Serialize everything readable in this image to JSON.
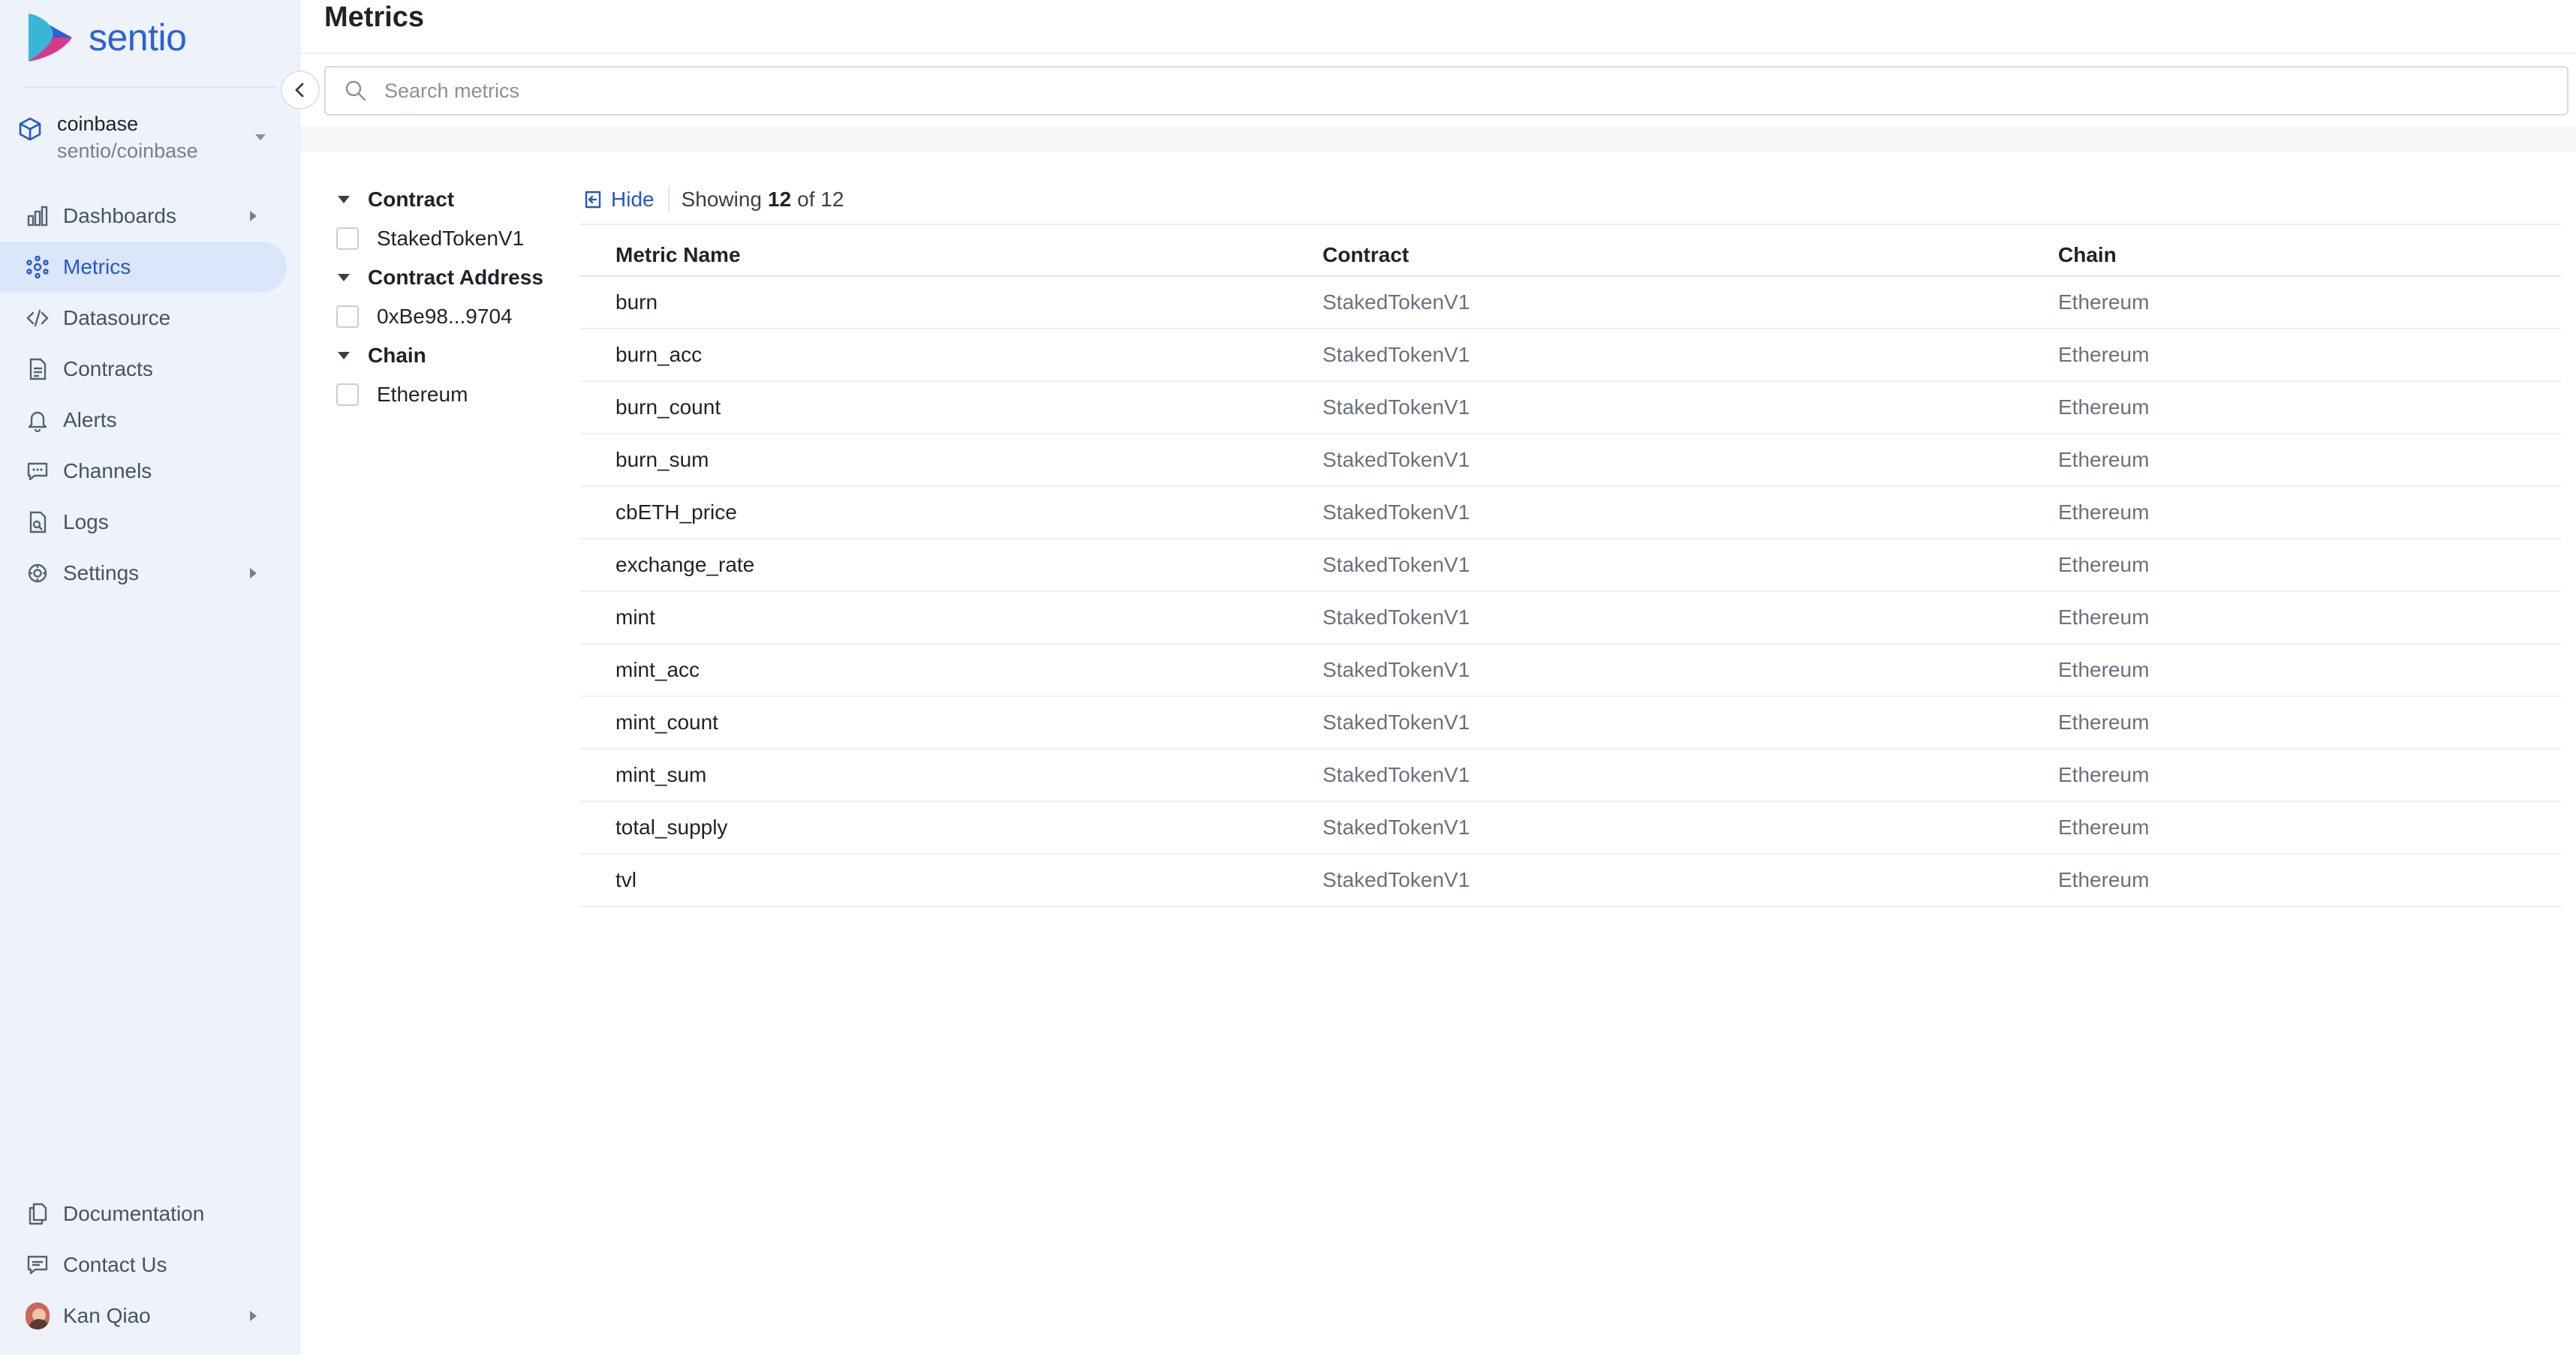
{
  "brand": {
    "name": "sentio"
  },
  "project": {
    "name": "coinbase",
    "slug": "sentio/coinbase"
  },
  "nav": {
    "items": [
      {
        "label": "Dashboards",
        "icon": "bar-chart-icon",
        "expandable": true,
        "active": false
      },
      {
        "label": "Metrics",
        "icon": "metrics-icon",
        "expandable": false,
        "active": true
      },
      {
        "label": "Datasource",
        "icon": "code-icon",
        "expandable": false,
        "active": false
      },
      {
        "label": "Contracts",
        "icon": "document-icon",
        "expandable": false,
        "active": false
      },
      {
        "label": "Alerts",
        "icon": "bell-icon",
        "expandable": false,
        "active": false
      },
      {
        "label": "Channels",
        "icon": "chat-bubble-icon",
        "expandable": false,
        "active": false
      },
      {
        "label": "Logs",
        "icon": "log-file-icon",
        "expandable": false,
        "active": false
      },
      {
        "label": "Settings",
        "icon": "gear-icon",
        "expandable": true,
        "active": false
      }
    ],
    "bottom": [
      {
        "label": "Documentation",
        "icon": "docs-icon"
      },
      {
        "label": "Contact Us",
        "icon": "message-icon"
      },
      {
        "label": "Kan Qiao",
        "icon": "avatar"
      }
    ]
  },
  "page": {
    "title": "Metrics"
  },
  "search": {
    "placeholder": "Search metrics",
    "value": ""
  },
  "facets": [
    {
      "title": "Contract",
      "options": [
        "StakedTokenV1"
      ]
    },
    {
      "title": "Contract Address",
      "options": [
        "0xBe98...9704"
      ]
    },
    {
      "title": "Chain",
      "options": [
        "Ethereum"
      ]
    }
  ],
  "toolbar": {
    "hide_label": "Hide",
    "showing_prefix": "Showing",
    "shown": "12",
    "of_text": "of 12"
  },
  "table": {
    "columns": [
      "Metric Name",
      "Contract",
      "Chain"
    ],
    "rows": [
      [
        "burn",
        "StakedTokenV1",
        "Ethereum"
      ],
      [
        "burn_acc",
        "StakedTokenV1",
        "Ethereum"
      ],
      [
        "burn_count",
        "StakedTokenV1",
        "Ethereum"
      ],
      [
        "burn_sum",
        "StakedTokenV1",
        "Ethereum"
      ],
      [
        "cbETH_price",
        "StakedTokenV1",
        "Ethereum"
      ],
      [
        "exchange_rate",
        "StakedTokenV1",
        "Ethereum"
      ],
      [
        "mint",
        "StakedTokenV1",
        "Ethereum"
      ],
      [
        "mint_acc",
        "StakedTokenV1",
        "Ethereum"
      ],
      [
        "mint_count",
        "StakedTokenV1",
        "Ethereum"
      ],
      [
        "mint_sum",
        "StakedTokenV1",
        "Ethereum"
      ],
      [
        "total_supply",
        "StakedTokenV1",
        "Ethereum"
      ],
      [
        "tvl",
        "StakedTokenV1",
        "Ethereum"
      ]
    ]
  },
  "colors": {
    "accent": "#2358c8",
    "sidebar_bg": "#eef2fa",
    "active_bg": "#dbe6fb"
  }
}
